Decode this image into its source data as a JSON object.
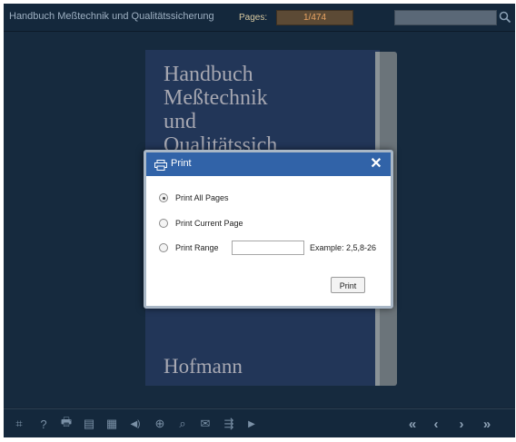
{
  "header": {
    "book_title": "Handbuch Meßtechnik und Qualitätssicherung",
    "pages_label": "Pages:",
    "page_value": "1/474"
  },
  "cover": {
    "title": "Handbuch\nMeßtechnik\nund\nQualitätssich",
    "author": "Hofmann"
  },
  "dialog": {
    "title": "Print",
    "close_symbol": "✕",
    "options": [
      {
        "label": "Print All Pages",
        "selected": true
      },
      {
        "label": "Print Current Page",
        "selected": false
      },
      {
        "label": "Print Range",
        "selected": false
      }
    ],
    "range_value": "",
    "range_hint": "Example: 2,5,8-26",
    "print_button": "Print"
  },
  "toolbar": {
    "icons": [
      "fullscreen-icon",
      "help-icon",
      "print-icon",
      "document-icon",
      "thumbnails-icon",
      "sound-icon",
      "zoom-in-icon",
      "search-icon",
      "email-icon",
      "share-icon",
      "autoplay-icon"
    ],
    "glyphs": {
      "fullscreen": "⌗",
      "help": "?",
      "print": "🖶",
      "document": "▤",
      "thumbnails": "▦",
      "sound": "◀)",
      "zoom_in": "⊕",
      "search": "⌕",
      "email": "✉",
      "share": "⇶",
      "autoplay": "▶",
      "first": "«",
      "prev": "‹",
      "next": "›",
      "last": "»"
    }
  },
  "colors": {
    "background": "#152638",
    "dialog_header": "#3163a8",
    "page_field": "#5c4a35",
    "page_text": "#e9a463"
  }
}
